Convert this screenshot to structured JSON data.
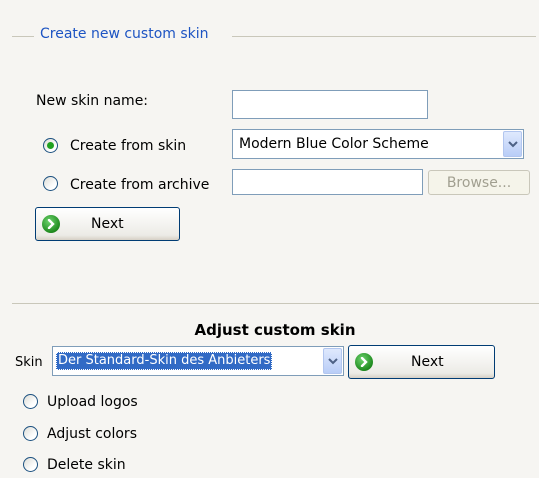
{
  "create_section": {
    "legend": "Create new custom skin",
    "new_skin_name_label": "New skin name:",
    "new_skin_name_value": "",
    "create_from_skin_label": "Create from skin",
    "create_from_skin_selected": true,
    "skin_dropdown_value": "Modern Blue Color Scheme",
    "create_from_archive_label": "Create from archive",
    "create_from_archive_selected": false,
    "archive_path_value": "",
    "browse_label": "Browse...",
    "next_label": "Next"
  },
  "adjust_section": {
    "heading": "Adjust custom skin",
    "skin_label": "Skin",
    "skin_dropdown_value": "Der Standard-Skin des Anbieters",
    "next_label": "Next",
    "options": [
      {
        "label": "Upload logos",
        "selected": false
      },
      {
        "label": "Adjust colors",
        "selected": false
      },
      {
        "label": "Delete skin",
        "selected": false
      }
    ]
  },
  "colors": {
    "legend_text": "#1d54c3",
    "radio_dot": "#21a121",
    "selection_highlight": "#316ac5"
  },
  "icons": {
    "next": "go-arrow-icon",
    "dropdown": "chevron-down-icon"
  }
}
